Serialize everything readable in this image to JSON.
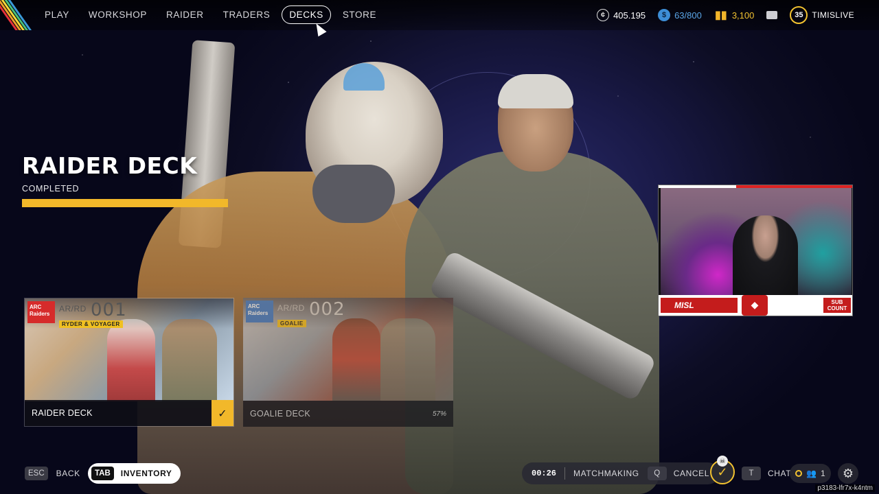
{
  "nav": {
    "items": [
      {
        "label": "PLAY",
        "active": false
      },
      {
        "label": "WORKSHOP",
        "active": false
      },
      {
        "label": "RAIDER",
        "active": false
      },
      {
        "label": "TRADERS",
        "active": false
      },
      {
        "label": "DECKS",
        "active": true
      },
      {
        "label": "STORE",
        "active": false
      }
    ]
  },
  "currencies": {
    "coins": "405.195",
    "blue_value": "63/800",
    "gold_value": "3,100",
    "level": "35",
    "username": "TIMISLIVE"
  },
  "deck": {
    "title": "RAIDER DECK",
    "status": "COMPLETED",
    "progress_fraction": 1.0
  },
  "cards": [
    {
      "brand": "ARC Raiders",
      "code": "AR/RD",
      "number": "001",
      "subtitle": "RYDER & VOYAGER",
      "label": "RAIDER DECK",
      "completed": true
    },
    {
      "brand": "ARC Raiders",
      "code": "AR/RD",
      "number": "002",
      "subtitle": "GOALIE",
      "label": "GOALIE DECK",
      "percent": "57%"
    }
  ],
  "webcam": {
    "brand": "MISL",
    "sub_label": "SUB COUNT"
  },
  "bottom": {
    "back_key": "ESC",
    "back_label": "BACK",
    "inventory_key": "TAB",
    "inventory_label": "INVENTORY",
    "timer": "00:26",
    "matchmaking_label": "MATCHMAKING",
    "cancel_key": "Q",
    "cancel_label": "CANCEL",
    "chat_key": "T",
    "chat_label": "CHAT",
    "party_count": "1"
  },
  "build_id": "p3183-lfr7x-k4ntm",
  "colors": {
    "accent_gold": "#f2b82a",
    "accent_blue": "#5aa6e8",
    "brand_red": "#c41c1c"
  },
  "icons": [
    "coin-icon",
    "blue-token-icon",
    "gold-currency-icon",
    "mail-icon",
    "level-badge",
    "check-icon",
    "ready-check-icon",
    "skull-icon",
    "party-icon",
    "gear-icon",
    "cursor-icon"
  ]
}
